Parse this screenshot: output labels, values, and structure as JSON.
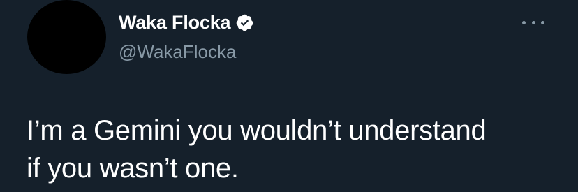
{
  "author": {
    "display_name": "Waka Flocka",
    "handle": "@WakaFlocka",
    "verified": true,
    "verified_icon": "verified-badge-icon"
  },
  "tweet": {
    "text_line_1": "I’m a Gemini you wouldn’t understand",
    "text_line_2": "if you wasn’t one."
  },
  "menu": {
    "icon": "more-options-icon"
  },
  "colors": {
    "background": "#15202b",
    "text": "#ffffff",
    "secondary_text": "#8899a6",
    "avatar": "#000000"
  }
}
